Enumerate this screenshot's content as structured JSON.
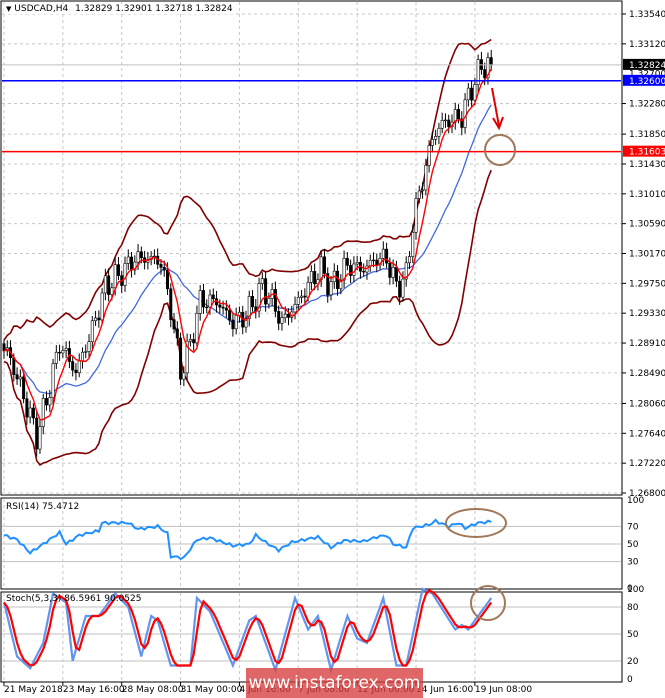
{
  "header": {
    "symbol": "USDCAD,H4",
    "open": "1.32829",
    "high": "1.32901",
    "low": "1.32718",
    "close": "1.32824"
  },
  "price_axis": {
    "ticks": [
      "1.33540",
      "1.33120",
      "1.32280",
      "1.31850",
      "1.31430",
      "1.31010",
      "1.30590",
      "1.30170",
      "1.29750",
      "1.29330",
      "1.28910",
      "1.28490",
      "1.28060",
      "1.27640",
      "1.27220",
      "1.26800"
    ],
    "tick_values": [
      1.3354,
      1.3312,
      1.3228,
      1.3185,
      1.3143,
      1.3101,
      1.3059,
      1.3017,
      1.2975,
      1.2933,
      1.2891,
      1.2849,
      1.2806,
      1.2764,
      1.2722,
      1.268
    ],
    "current_label": "1.32824",
    "current_value": 1.32824,
    "hidden_label": "1.32700",
    "blue_level_label": "1.32600",
    "blue_level": 1.326,
    "red_level_label": "1.31603",
    "red_level": 1.31603
  },
  "time_axis": {
    "labels": [
      "21 May 2018",
      "23 May 16:00",
      "28 May 08:00",
      "31 May 00:00",
      "4 Jun 16:00",
      "7 Jun 08:00",
      "12 Jun 00:00",
      "14 Jun 16:00",
      "19 Jun 08:00"
    ],
    "label_bars": [
      0,
      18,
      36,
      54,
      72,
      90,
      108,
      126,
      144
    ]
  },
  "rsi": {
    "label": "RSI(14) 75.4712",
    "levels": [
      "100",
      "70",
      "50",
      "30",
      "0"
    ],
    "level_values": [
      100,
      70,
      50,
      30,
      0
    ]
  },
  "stoch": {
    "label": "Stoch(5,3,3) 86.5961 90.0525",
    "levels": [
      "100",
      "80",
      "50",
      "20",
      "0"
    ],
    "level_values": [
      100,
      80,
      50,
      20,
      0
    ]
  },
  "colors": {
    "candle": "#000000",
    "bands": "#800000",
    "fast_ma": "#ff0000",
    "slow_ma": "#4169e1",
    "rsi": "#1e90ff",
    "stoch_main": "#6495ed",
    "stoch_signal": "#ff0000",
    "blue_level": "#0000ff",
    "red_level": "#ff0000",
    "annotation": "#a0785a"
  },
  "watermark": "www.instaforex.com",
  "chart_data": {
    "type": "candlestick",
    "bars": 150,
    "price_path": [
      [
        0,
        1.288
      ],
      [
        1,
        1.288
      ],
      [
        5,
        1.283
      ],
      [
        10,
        1.276
      ],
      [
        13,
        1.281
      ],
      [
        17,
        1.289
      ],
      [
        22,
        1.285
      ],
      [
        27,
        1.291
      ],
      [
        31,
        1.297
      ],
      [
        36,
        1.299
      ],
      [
        40,
        1.301
      ],
      [
        45,
        1.301
      ],
      [
        48,
        1.3005
      ],
      [
        51,
        1.294
      ],
      [
        54,
        1.285
      ],
      [
        57,
        1.289
      ],
      [
        60,
        1.295
      ],
      [
        65,
        1.295
      ],
      [
        70,
        1.292
      ],
      [
        74,
        1.293
      ],
      [
        79,
        1.297
      ],
      [
        82,
        1.295
      ],
      [
        85,
        1.292
      ],
      [
        90,
        1.295
      ],
      [
        94,
        1.298
      ],
      [
        97,
        1.2995
      ],
      [
        100,
        1.297
      ],
      [
        105,
        1.3
      ],
      [
        110,
        1.2995
      ],
      [
        114,
        1.301
      ],
      [
        117,
        1.301
      ],
      [
        120,
        1.297
      ],
      [
        123,
        1.2985
      ],
      [
        125,
        1.306
      ],
      [
        128,
        1.312
      ],
      [
        131,
        1.318
      ],
      [
        134,
        1.32
      ],
      [
        137,
        1.3205
      ],
      [
        140,
        1.321
      ],
      [
        143,
        1.325
      ],
      [
        146,
        1.328
      ],
      [
        149,
        1.32824
      ]
    ],
    "rsi_path": [
      [
        0,
        60
      ],
      [
        4,
        55
      ],
      [
        8,
        40
      ],
      [
        12,
        50
      ],
      [
        17,
        63
      ],
      [
        19,
        50
      ],
      [
        23,
        60
      ],
      [
        29,
        65
      ],
      [
        30,
        74
      ],
      [
        38,
        74
      ],
      [
        41,
        67
      ],
      [
        47,
        70
      ],
      [
        50,
        62
      ],
      [
        51,
        36
      ],
      [
        55,
        34
      ],
      [
        59,
        55
      ],
      [
        63,
        57
      ],
      [
        70,
        48
      ],
      [
        75,
        50
      ],
      [
        77,
        60
      ],
      [
        80,
        52
      ],
      [
        84,
        43
      ],
      [
        88,
        52
      ],
      [
        96,
        58
      ],
      [
        100,
        46
      ],
      [
        104,
        54
      ],
      [
        110,
        53
      ],
      [
        114,
        58
      ],
      [
        117,
        60
      ],
      [
        119,
        50
      ],
      [
        123,
        46
      ],
      [
        125,
        68
      ],
      [
        130,
        72
      ],
      [
        132,
        76
      ],
      [
        136,
        70
      ],
      [
        139,
        74
      ],
      [
        141,
        68
      ],
      [
        145,
        74
      ],
      [
        149,
        75.47
      ]
    ],
    "stoch_path": [
      [
        0,
        85
      ],
      [
        4,
        25
      ],
      [
        8,
        12
      ],
      [
        12,
        40
      ],
      [
        15,
        95
      ],
      [
        19,
        85
      ],
      [
        21,
        20
      ],
      [
        25,
        70
      ],
      [
        29,
        70
      ],
      [
        34,
        95
      ],
      [
        38,
        80
      ],
      [
        42,
        25
      ],
      [
        45,
        70
      ],
      [
        47,
        65
      ],
      [
        51,
        15
      ],
      [
        57,
        15
      ],
      [
        59,
        90
      ],
      [
        63,
        75
      ],
      [
        70,
        15
      ],
      [
        75,
        65
      ],
      [
        77,
        70
      ],
      [
        83,
        10
      ],
      [
        89,
        90
      ],
      [
        93,
        55
      ],
      [
        96,
        70
      ],
      [
        100,
        10
      ],
      [
        105,
        70
      ],
      [
        108,
        45
      ],
      [
        111,
        40
      ],
      [
        116,
        90
      ],
      [
        120,
        15
      ],
      [
        123,
        15
      ],
      [
        128,
        100
      ],
      [
        131,
        95
      ],
      [
        138,
        55
      ],
      [
        140,
        60
      ],
      [
        142,
        55
      ],
      [
        149,
        90
      ]
    ],
    "indicators": [
      "Bollinger Bands(20,2)",
      "MA fast",
      "MA slow"
    ]
  }
}
